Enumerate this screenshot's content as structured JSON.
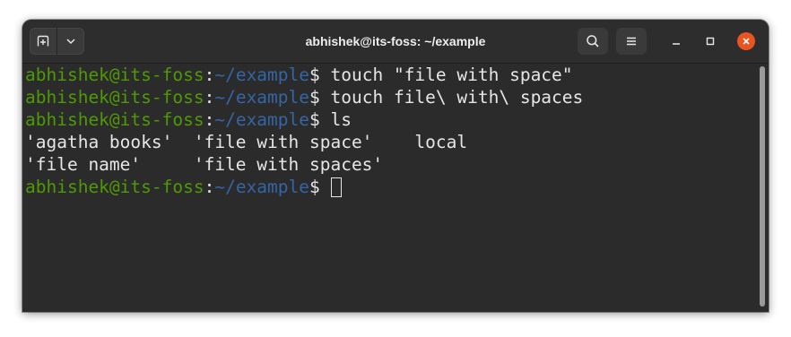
{
  "window": {
    "title": "abhishek@its-foss: ~/example"
  },
  "titlebar": {
    "new_tab_icon": "new-tab-icon",
    "dropdown_icon": "chevron-down-icon",
    "search_icon": "search-icon",
    "menu_icon": "hamburger-menu-icon",
    "minimize_icon": "minimize-icon",
    "maximize_icon": "maximize-icon",
    "close_icon": "close-icon"
  },
  "prompt": {
    "user": "abhishek@its-foss",
    "colon": ":",
    "path": "~/example",
    "dollar": "$"
  },
  "terminal": {
    "commands": [
      " touch \"file with space\"",
      " touch file\\ with\\ spaces",
      " ls"
    ],
    "output": [
      "'agatha books'  'file with space'    local",
      "'file name'     'file with spaces'"
    ],
    "current_input": " "
  },
  "colors": {
    "prompt_user": "#4e9a06",
    "prompt_path": "#3465a4",
    "terminal_bg": "#2b2b2b",
    "text": "#e6e6e6",
    "close_button": "#e95420"
  }
}
